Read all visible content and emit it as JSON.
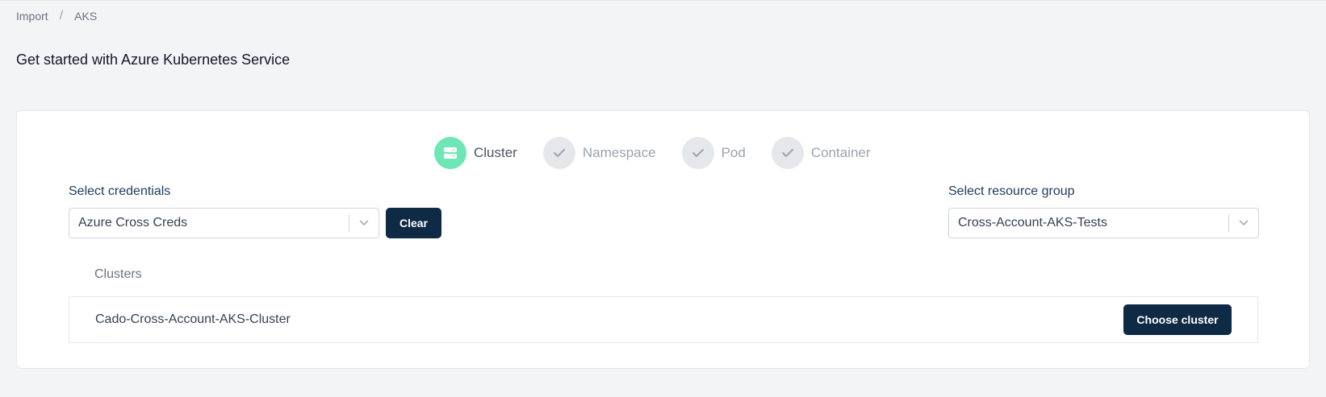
{
  "breadcrumb": {
    "items": [
      "Import",
      "AKS"
    ],
    "separator": "/"
  },
  "page": {
    "title": "Get started with Azure Kubernetes Service"
  },
  "stepper": {
    "steps": [
      {
        "label": "Cluster",
        "state": "active",
        "icon": "server-icon"
      },
      {
        "label": "Namespace",
        "state": "pending",
        "icon": "check-icon"
      },
      {
        "label": "Pod",
        "state": "pending",
        "icon": "check-icon"
      },
      {
        "label": "Container",
        "state": "pending",
        "icon": "check-icon"
      }
    ]
  },
  "credentials": {
    "label": "Select credentials",
    "value": "Azure Cross Creds",
    "clear_label": "Clear"
  },
  "resource_group": {
    "label": "Select resource group",
    "value": "Cross-Account-AKS-Tests"
  },
  "clusters": {
    "heading": "Clusters",
    "items": [
      {
        "name": "Cado-Cross-Account-AKS-Cluster",
        "action_label": "Choose cluster"
      }
    ]
  },
  "colors": {
    "accent_active": "#6ee7b7",
    "primary_button": "#0f2a45",
    "label_text": "#1e3a5f",
    "background": "#f3f4f6"
  }
}
